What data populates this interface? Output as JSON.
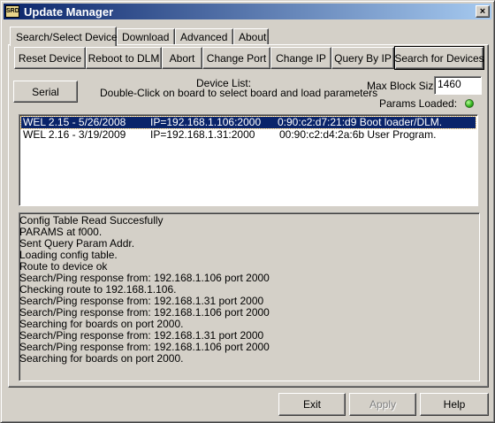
{
  "window": {
    "title": "Update Manager",
    "icon_text": "SRD",
    "close_glyph": "×"
  },
  "tabs": [
    {
      "label": "Search/Select Device",
      "active": true
    },
    {
      "label": "Download"
    },
    {
      "label": "Advanced"
    },
    {
      "label": "About"
    }
  ],
  "toolbar": {
    "reset": "Reset Device",
    "reboot": "Reboot to DLM",
    "abort": "Abort",
    "change_port": "Change Port",
    "change_ip": "Change IP",
    "query_ip": "Query By IP",
    "search": "Search for Devices"
  },
  "serial_button": "Serial",
  "device_list": {
    "heading": "Device List:",
    "hint": "Double-Click on board to select board and load parameters",
    "rows": [
      {
        "name": "WEL 2.15 - 5/26/2008",
        "ip": "IP=192.168.1.106:2000",
        "info": "0:90:c2:d7:21:d9 Boot loader/DLM.",
        "selected": true
      },
      {
        "name": "WEL 2.16 - 3/19/2009",
        "ip": "IP=192.168.1.31:2000",
        "info": "00:90:c2:d4:2a:6b User Program.",
        "selected": false
      }
    ]
  },
  "max_block": {
    "label": "Max Block Size",
    "value": "1460"
  },
  "params_loaded": {
    "label": "Params Loaded:",
    "status": "loaded",
    "color": "#2fb01a"
  },
  "log_lines": [
    "Config Table Read Succesfully",
    "PARAMS at f000.",
    "Sent Query Param Addr.",
    "Loading config table.",
    "Route to device ok",
    "Search/Ping response from: 192.168.1.106 port 2000",
    "Checking route to 192.168.1.106.",
    "Search/Ping response from: 192.168.1.31 port 2000",
    "Search/Ping response from: 192.168.1.106 port 2000",
    "Searching for boards on port 2000.",
    "Search/Ping response from: 192.168.1.31 port 2000",
    "Search/Ping response from: 192.168.1.106 port 2000",
    "Searching for boards on port 2000."
  ],
  "footer": {
    "exit": "Exit",
    "apply": "Apply",
    "help": "Help"
  }
}
